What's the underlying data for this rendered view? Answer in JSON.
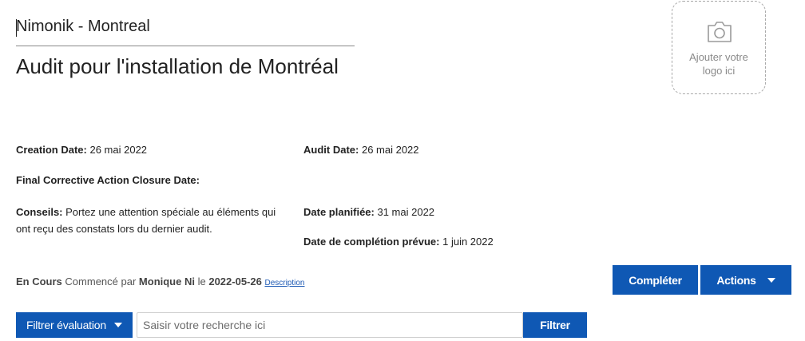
{
  "header": {
    "company": "Nimonik - Montreal",
    "title": "Audit pour l'installation de Montréal"
  },
  "logo": {
    "line1": "Ajouter votre",
    "line2": "logo ici",
    "icon": "camera-icon"
  },
  "details": {
    "creation_label": "Creation Date:",
    "creation_value": "26 mai 2022",
    "audit_label": "Audit Date:",
    "audit_value": "26 mai 2022",
    "closure_label": "Final Corrective Action Closure Date:",
    "closure_value": "",
    "tips_label": "Conseils:",
    "tips_line1": "Portez une attention spéciale au éléments qui",
    "tips_line2": "ont reçu des constats lors du dernier audit.",
    "planned_label": "Date planifiée:",
    "planned_value": "31 mai 2022",
    "expected_label": "Date de complétion prévue:",
    "expected_value": "1 juin 2022"
  },
  "status": {
    "state": "En Cours",
    "started_by_text": "Commencé par",
    "user": "Monique Ni",
    "on_text": "le",
    "date": "2022-05-26",
    "description_link": "Description"
  },
  "actions": {
    "complete_label": "Compléter",
    "actions_label": "Actions"
  },
  "filter": {
    "filter_eval_label": "Filtrer évaluation",
    "search_placeholder": "Saisir votre recherche ici",
    "search_value": "",
    "filter_button_label": "Filtrer"
  },
  "colors": {
    "primary": "#0f58b4",
    "link": "#1f5bb5"
  }
}
